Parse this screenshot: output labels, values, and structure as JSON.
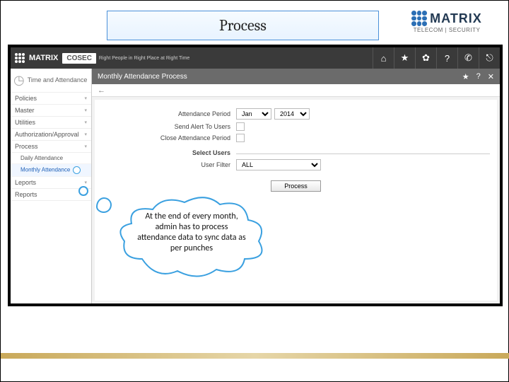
{
  "title": "Process",
  "brand": {
    "name": "MATRIX",
    "subtitle": "TELECOM | SECURITY"
  },
  "app": {
    "name": "MATRIX",
    "product": "COSEC",
    "tagline": "Right People in Right Place at Right Time",
    "header_icons": {
      "home": "⌂",
      "star": "★",
      "gear": "✿",
      "help": "?",
      "phone": "✆",
      "logout": "⎋"
    }
  },
  "sidebar": {
    "module_icon": "◷",
    "module_title": "Time and Attendance",
    "items": [
      {
        "label": "Policies",
        "expandable": true
      },
      {
        "label": "Master",
        "expandable": true
      },
      {
        "label": "Utilities",
        "expandable": true
      },
      {
        "label": "Authorization/Approval",
        "expandable": true
      },
      {
        "label": "Process",
        "expandable": true
      },
      {
        "label": "Daily Attendance",
        "expandable": false,
        "sub": true
      },
      {
        "label": "Monthly Attendance",
        "expandable": false,
        "sub": true,
        "highlight": true
      },
      {
        "label": "Leports",
        "expandable": true
      },
      {
        "label": "Reports",
        "expandable": true
      }
    ]
  },
  "content": {
    "title": "Monthly Attendance Process",
    "bar_icons": {
      "star": "★",
      "help": "?",
      "close": "✕"
    },
    "back": "←",
    "fields": {
      "attendance_period_label": "Attendance Period",
      "month_value": "Jan",
      "year_value": "2014",
      "send_alert_label": "Send Alert To Users",
      "close_period_label": "Close Attendance Period",
      "section_label": "Select Users",
      "user_filter_label": "User Filter",
      "user_filter_value": "ALL",
      "process_btn": "Process"
    }
  },
  "annotation": {
    "text": "At the end of every month, admin has to process attendance data to sync data as per punches"
  }
}
